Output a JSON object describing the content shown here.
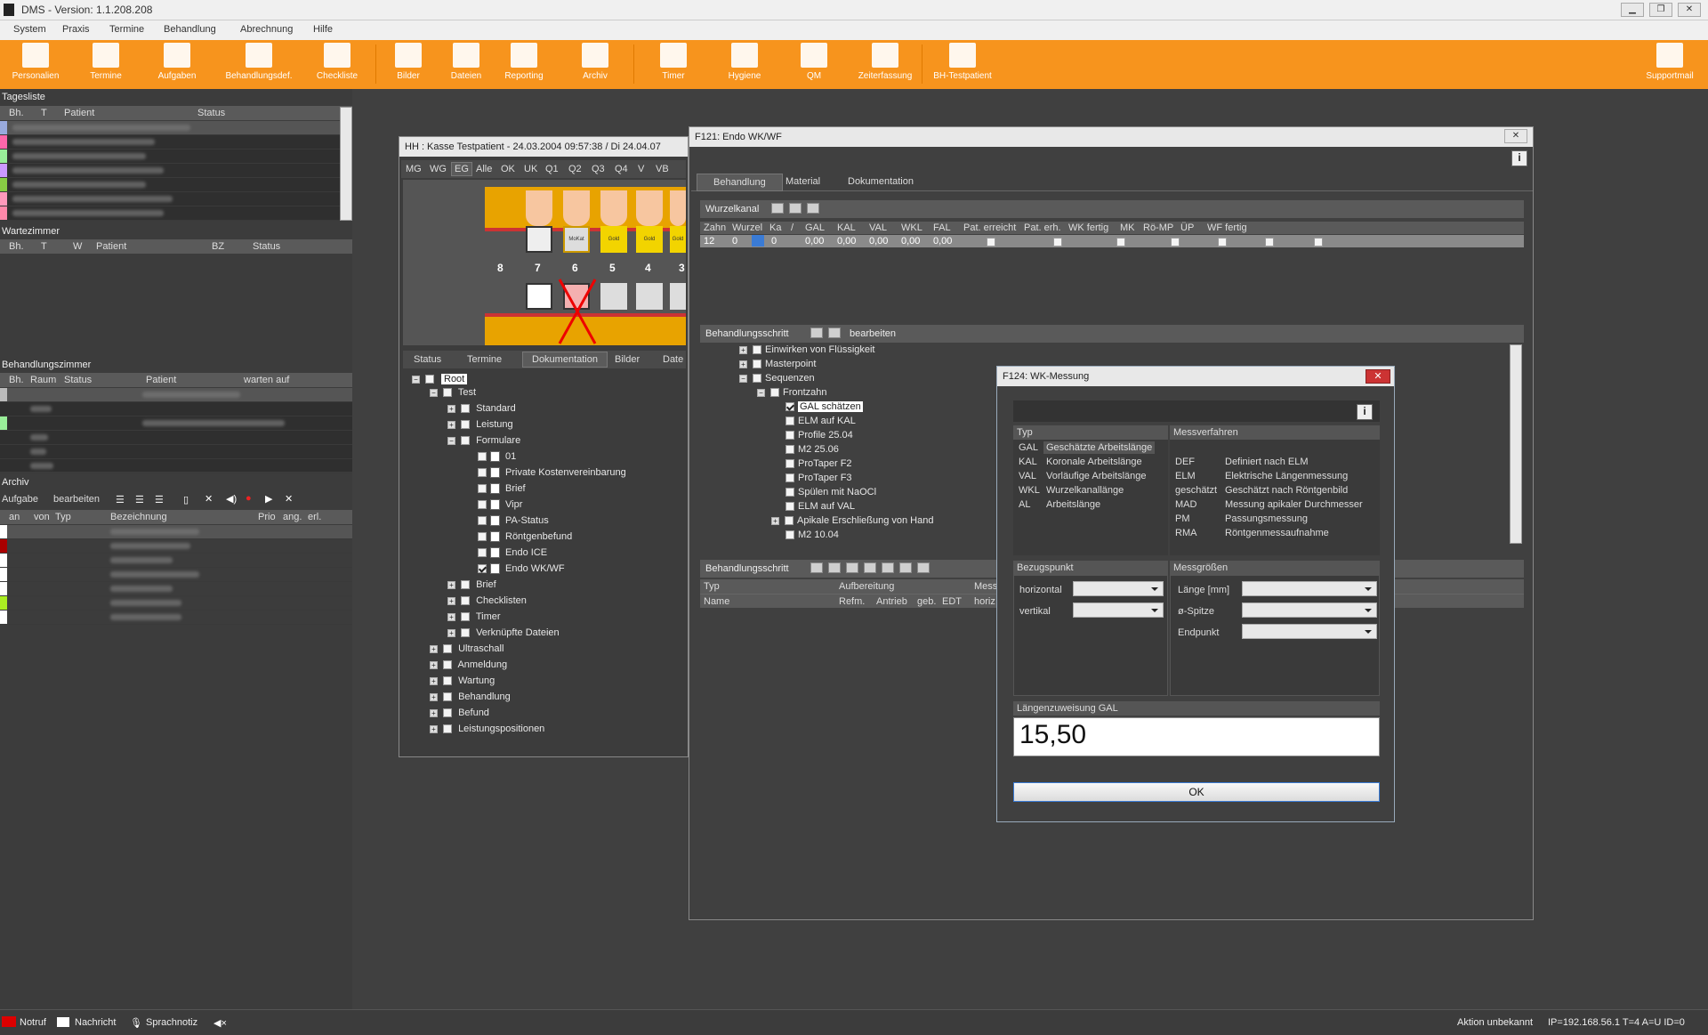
{
  "window": {
    "title": "DMS  -  Version: 1.1.208.208"
  },
  "menu": [
    "System",
    "Praxis",
    "Termine",
    "Behandlung",
    "Abrechnung",
    "Hilfe"
  ],
  "toolbar": [
    "Personalien",
    "Termine",
    "Aufgaben",
    "Behandlungsdef.",
    "Checkliste",
    "Bilder",
    "Dateien",
    "Reporting",
    "Archiv",
    "Timer",
    "Hygiene",
    "QM",
    "Zeiterfassung",
    "BH-Testpatient",
    "Supportmail"
  ],
  "tagesliste": {
    "title": "Tagesliste",
    "cols": [
      "Bh.",
      "T",
      "Patient",
      "Status"
    ]
  },
  "wartezimmer": {
    "title": "Wartezimmer",
    "cols": [
      "Bh.",
      "T",
      "W",
      "Patient",
      "BZ",
      "Status"
    ]
  },
  "behandlungszimmer": {
    "title": "Behandlungszimmer",
    "cols": [
      "Bh.",
      "Raum",
      "Status",
      "Patient",
      "warten auf"
    ]
  },
  "archiv": {
    "title": "Archiv",
    "aufgabe": "Aufgabe",
    "bearbeiten": "bearbeiten",
    "cols": [
      "an",
      "von",
      "Typ",
      "Bezeichnung",
      "Prio",
      "ang.",
      "erl."
    ]
  },
  "patient_window": {
    "title": "HH : Kasse Testpatient - 24.03.2004 09:57:38 / Di 24.04.07",
    "quadrants": [
      "MG",
      "WG",
      "EG",
      "Alle",
      "OK",
      "UK",
      "Q1",
      "Q2",
      "Q3",
      "Q4",
      "V",
      "VB"
    ],
    "tooth_numbers": [
      "8",
      "7",
      "6",
      "5",
      "4",
      "3"
    ],
    "crown_labels": [
      "MoKat",
      "Gold",
      "Gold",
      "Gold"
    ],
    "tabs": [
      "Status",
      "Termine",
      "Dokumentation",
      "Bilder",
      "Date"
    ],
    "tree": [
      "Root",
      "Test",
      "Standard",
      "Leistung",
      "Formulare",
      "01",
      "Private Kostenvereinbarung",
      "Brief",
      "Vipr",
      "PA-Status",
      "Röntgenbefund",
      "Endo ICE",
      "Endo WK/WF",
      "Brief",
      "Checklisten",
      "Timer",
      "Verknüpfte Dateien",
      "Ultraschall",
      "Anmeldung",
      "Wartung",
      "Behandlung",
      "Befund",
      "Leistungspositionen"
    ]
  },
  "endo_window": {
    "title": "F121: Endo WK/WF",
    "tabs": [
      "Behandlung",
      "Material",
      "Dokumentation"
    ],
    "wurzelkanal": "Wurzelkanal",
    "cols": [
      "Zahn",
      "Wurzel",
      "Ka",
      "/",
      "GAL",
      "KAL",
      "VAL",
      "WKL",
      "FAL",
      "Pat. erreicht",
      "Pat. erh.",
      "WK fertig",
      "MK",
      "Rö-MP",
      "ÜP",
      "WF fertig"
    ],
    "row": [
      "12",
      "0",
      "0",
      "0,00",
      "0,00",
      "0,00",
      "0,00",
      "0,00"
    ],
    "behandlungsschritt": "Behandlungsschritt",
    "bearbeiten": "bearbeiten",
    "steps": [
      "Einwirken von Flüssigkeit",
      "Masterpoint",
      "Sequenzen",
      "Frontzahn",
      "GAL schätzen",
      "ELM auf KAL",
      "Profile 25.04",
      "M2 25.06",
      "ProTaper F2",
      "ProTaper F3",
      "Spülen mit NaOCl",
      "ELM auf VAL",
      "Apikale Erschließung von Hand",
      "M2 10.04"
    ],
    "lower_title": "Behandlungsschritt",
    "lower_cols1": [
      "Typ",
      "Aufbereitung",
      "Mess"
    ],
    "lower_cols2": [
      "Name",
      "Refm.",
      "Antrieb",
      "geb.",
      "EDT",
      "horiz"
    ]
  },
  "wk_dialog": {
    "title": "F124: WK-Messung",
    "typ_label": "Typ",
    "typ": [
      [
        "GAL",
        "Geschätzte Arbeitslänge"
      ],
      [
        "KAL",
        "Koronale Arbeitslänge"
      ],
      [
        "VAL",
        "Vorläufige Arbeitslänge"
      ],
      [
        "WKL",
        "Wurzelkanallänge"
      ],
      [
        "AL",
        "Arbeitslänge"
      ]
    ],
    "mess_label": "Messverfahren",
    "mess": [
      [
        "DEF",
        "Definiert nach ELM"
      ],
      [
        "ELM",
        "Elektrische Längenmessung"
      ],
      [
        "geschätzt",
        "Geschätzt nach Röntgenbild"
      ],
      [
        "MAD",
        "Messung apikaler Durchmesser"
      ],
      [
        "PM",
        "Passungsmessung"
      ],
      [
        "RMA",
        "Röntgenmessaufnahme"
      ]
    ],
    "bezug_label": "Bezugspunkt",
    "horizontal": "horizontal",
    "vertikal": "vertikal",
    "messgr_label": "Messgrößen",
    "laenge": "Länge [mm]",
    "spitze": "ø-Spitze",
    "endpunkt": "Endpunkt",
    "gal_label": "Längenzuweisung GAL",
    "gal_value": "15,50",
    "ok": "OK"
  },
  "status": {
    "notruf": "Notruf",
    "nachricht": "Nachricht",
    "sprachnotiz": "Sprachnotiz",
    "aktion": "Aktion unbekannt",
    "ip": "IP=192.168.56.1  T=4   A=U  ID=0"
  },
  "colors": {
    "accent": "#f7941d",
    "bg": "#404040",
    "panel": "#3c3c3c"
  }
}
